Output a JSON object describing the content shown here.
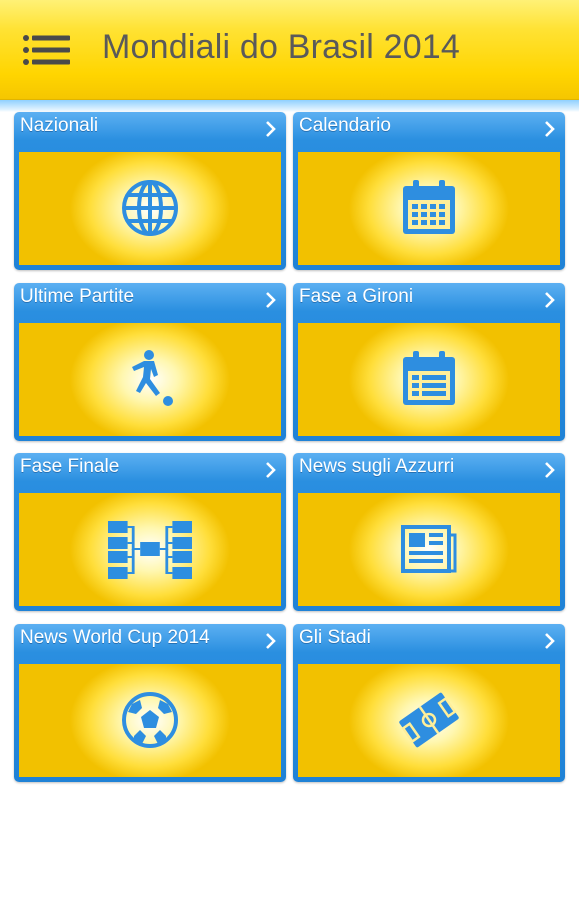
{
  "app": {
    "title": "Mondiali do Brasil 2014",
    "menu_icon": "hamburger-menu-icon"
  },
  "colors": {
    "appbar_yellow": "#ffd500",
    "tile_blue": "#1f82d6",
    "icon_blue": "#2e8ee0",
    "panel_yellow": "#f2c100"
  },
  "tiles": [
    {
      "label": "Nazionali",
      "icon": "globe-icon"
    },
    {
      "label": "Calendario",
      "icon": "calendar-icon"
    },
    {
      "label": "Ultime Partite",
      "icon": "soccer-player-icon"
    },
    {
      "label": "Fase a Gironi",
      "icon": "calendar-list-icon"
    },
    {
      "label": "Fase Finale",
      "icon": "tournament-bracket-icon"
    },
    {
      "label": "News sugli Azzurri",
      "icon": "newspaper-icon"
    },
    {
      "label": "News World Cup 2014",
      "icon": "soccer-ball-icon"
    },
    {
      "label": "Gli Stadi",
      "icon": "stadium-field-icon"
    }
  ]
}
